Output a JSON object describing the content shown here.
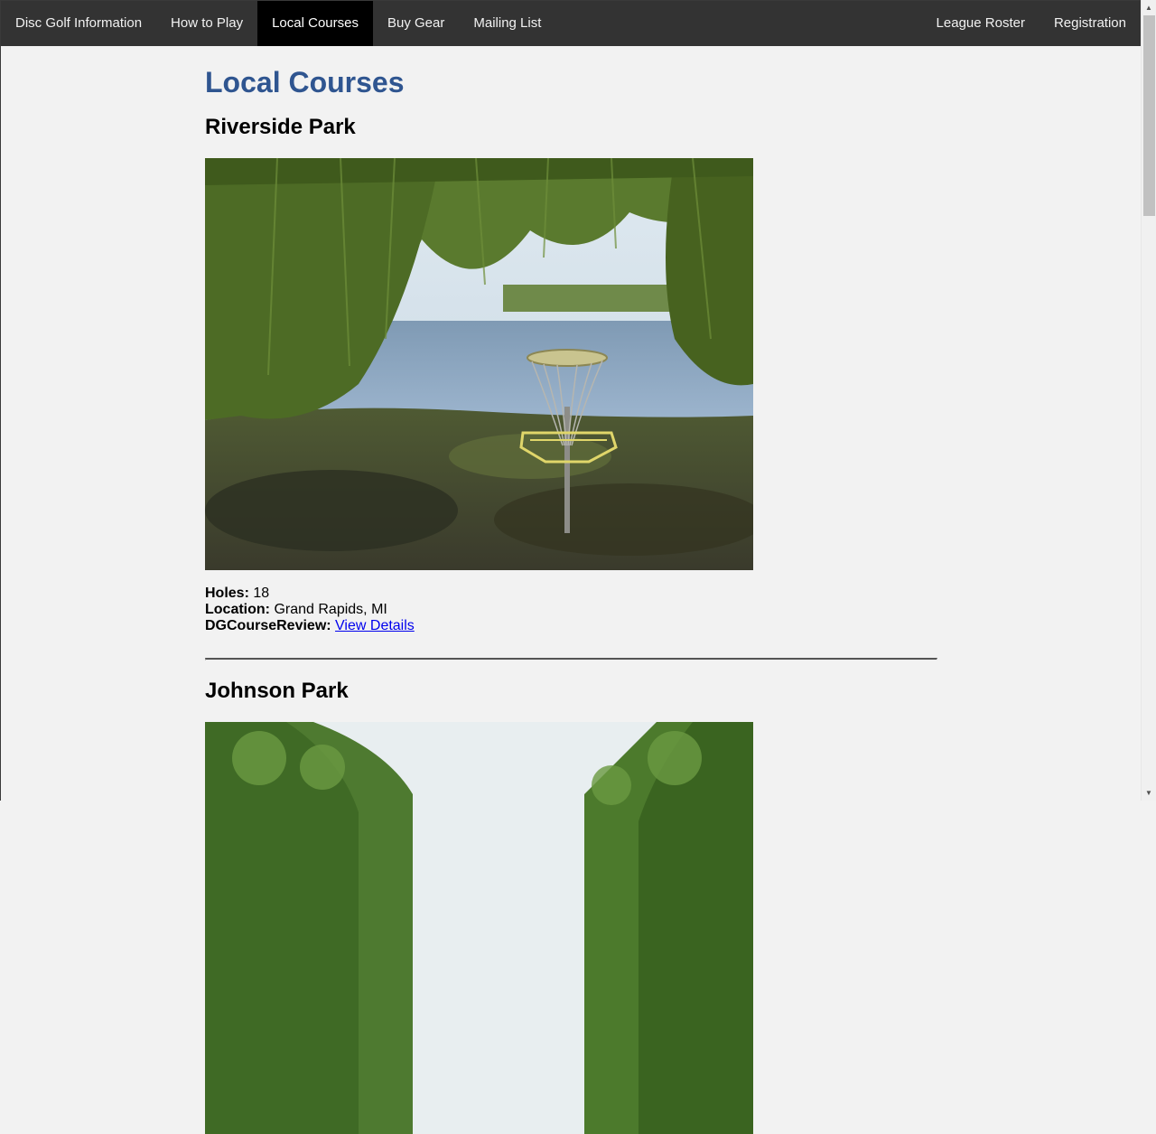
{
  "nav": {
    "left": [
      {
        "label": "Disc Golf Information"
      },
      {
        "label": "How to Play"
      },
      {
        "label": "Local Courses"
      },
      {
        "label": "Buy Gear"
      },
      {
        "label": "Mailing List"
      }
    ],
    "right": [
      {
        "label": "League Roster"
      },
      {
        "label": "Registration"
      }
    ]
  },
  "page": {
    "title": "Local Courses"
  },
  "courses": [
    {
      "name": "Riverside Park",
      "holes_label": "Holes:",
      "holes": "18",
      "location_label": "Location:",
      "location": "Grand Rapids, MI",
      "review_label": "DGCourseReview:",
      "review_link": "View Details"
    },
    {
      "name": "Johnson Park"
    }
  ],
  "colors": {
    "nav_bg": "#333333",
    "nav_active_bg": "#000000",
    "title": "#2f5590",
    "link": "#0000ee",
    "page_bg": "#f2f2f2"
  },
  "icons": {
    "scroll_up": "▲",
    "scroll_down": "▼"
  }
}
